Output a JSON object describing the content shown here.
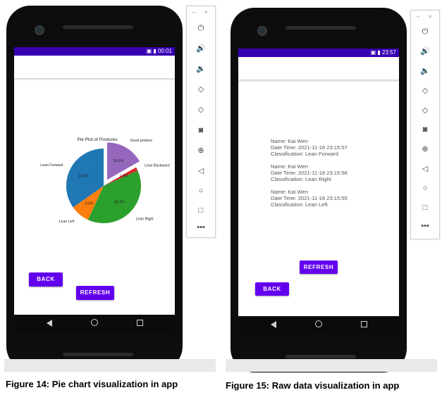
{
  "figure14": {
    "caption": "Figure 14: Pie chart visualization in app",
    "status_time": "00:01",
    "buttons": {
      "back": "BACK",
      "refresh": "REFRESH"
    },
    "chart_data": {
      "type": "pie",
      "title": "Pie Plot of Postures",
      "slices": [
        {
          "label": "Good posture",
          "value": 16.6,
          "value_label": "16.6%",
          "color": "#9467bd",
          "exploded": true
        },
        {
          "label": "Lean Backward",
          "value": 1.6,
          "value_label": "1.6%",
          "color": "#d62728",
          "exploded": false
        },
        {
          "label": "Lean Right",
          "value": 38.3,
          "value_label": "38.3%",
          "color": "#2ca02c",
          "exploded": false
        },
        {
          "label": "Lean Left",
          "value": 8.3,
          "value_label": "8.3%",
          "color": "#ff7f0e",
          "exploded": false
        },
        {
          "label": "Lean Forward",
          "value": 34.5,
          "value_label": "34.5%",
          "color": "#1f77b4",
          "exploded": false
        }
      ]
    }
  },
  "figure15": {
    "caption": "Figure 15: Raw data visualization in app",
    "status_time": "23:57",
    "buttons": {
      "refresh": "REFRESH",
      "back": "BACK"
    },
    "records": [
      {
        "name": "Name: Kai Wen",
        "datetime": "Date Time: 2021-11-18 23:15:57",
        "classification": "Classification: Lean Forward"
      },
      {
        "name": "Name: Kai Wen",
        "datetime": "Date Time: 2021-11-18 23:15:56",
        "classification": "Classification: Lean Right"
      },
      {
        "name": "Name: Kai Wen",
        "datetime": "Date Time: 2021-11-18 23:15:55",
        "classification": "Classification: Lean Left"
      }
    ]
  },
  "emulator_toolbar": {
    "window_controls": [
      "–",
      "×"
    ],
    "icons": [
      "power-icon",
      "volume-up-icon",
      "volume-down-icon",
      "rotate-left-icon",
      "rotate-right-icon",
      "camera-icon",
      "zoom-icon",
      "back-icon",
      "home-icon",
      "overview-icon",
      "more-icon"
    ]
  }
}
